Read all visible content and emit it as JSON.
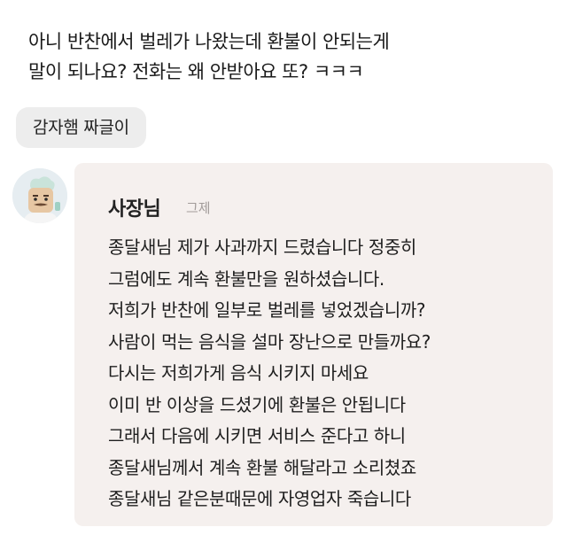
{
  "review": {
    "lines": [
      "아니 반찬에서 벌레가 나왔는데 환불이 안되는게",
      "말이 되나요? 전화는 왜 안받아요 또? ㅋㅋㅋ"
    ]
  },
  "tag": {
    "label": "감자햄 짜글이"
  },
  "reply": {
    "author": "사장님",
    "date": "그제",
    "lines": [
      "종달새님 제가 사과까지 드렸습니다 정중히",
      "그럼에도 계속 환불만을 원하셨습니다.",
      "저희가 반찬에 일부로 벌레를 넣었겠습니까?",
      "사람이 먹는 음식을 설마 장난으로 만들까요?",
      "다시는 저희가게 음식 시키지 마세요",
      "이미 반 이상을 드셨기에 환불은 안됩니다",
      "그래서 다음에 시키면 서비스 준다고 하니",
      "종달새님께서 계속 환불 해달라고 소리쳤죠",
      "종달새님 같은분때문에 자영업자 죽습니다"
    ]
  },
  "colors": {
    "reply_bg": "#f5f0ee",
    "chip_bg": "#ededed",
    "date_text": "#a29c9a"
  },
  "icons": {
    "owner_avatar": "chef-avatar-icon"
  }
}
